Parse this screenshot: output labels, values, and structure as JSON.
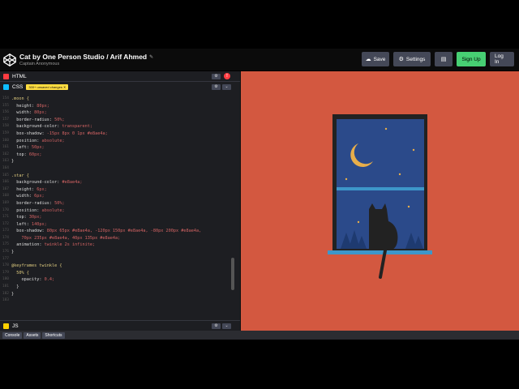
{
  "header": {
    "title": "Cat by One Person Studio / Arif Ahmed",
    "author": "Captain Anonymous",
    "buttons": {
      "save": "Save",
      "settings": "Settings",
      "signup": "Sign Up",
      "login": "Log In"
    }
  },
  "panels": {
    "html": {
      "label": "HTML",
      "error_count": "!"
    },
    "css": {
      "label": "CSS",
      "badge": "300+ unsaved changes ✕"
    },
    "js": {
      "label": "JS"
    }
  },
  "code_lines": [
    {
      "n": "154",
      "t": ".moon {",
      "cls": "sel"
    },
    {
      "n": "155",
      "t": "  height: 80px;",
      "cls": "decl",
      "prop": "  height",
      "val": "80px"
    },
    {
      "n": "156",
      "t": "  width: 80px;",
      "cls": "decl",
      "prop": "  width",
      "val": "80px"
    },
    {
      "n": "157",
      "t": "  border-radius: 50%;",
      "cls": "decl",
      "prop": "  border-radius",
      "val": "50%"
    },
    {
      "n": "158",
      "t": "  background-color: transparent;",
      "cls": "decl",
      "prop": "  background-color",
      "val": "transparent"
    },
    {
      "n": "159",
      "t": "  box-shadow: -15px 8px 0 1px #e8ae4a;",
      "cls": "decl",
      "prop": "  box-shadow",
      "val": "-15px 8px 0 1px #e8ae4a"
    },
    {
      "n": "160",
      "t": "  position: absolute;",
      "cls": "decl",
      "prop": "  position",
      "val": "absolute"
    },
    {
      "n": "161",
      "t": "  left: 50px;",
      "cls": "decl",
      "prop": "  left",
      "val": "50px"
    },
    {
      "n": "162",
      "t": "  top: 60px;",
      "cls": "decl",
      "prop": "  top",
      "val": "60px"
    },
    {
      "n": "163",
      "t": "}",
      "cls": "plain"
    },
    {
      "n": "164",
      "t": "",
      "cls": "plain"
    },
    {
      "n": "165",
      "t": ".star {",
      "cls": "sel"
    },
    {
      "n": "166",
      "t": "  background-color: #e8ae4a;",
      "cls": "decl",
      "prop": "  background-color",
      "val": "#e8ae4a"
    },
    {
      "n": "167",
      "t": "  height: 6px;",
      "cls": "decl",
      "prop": "  height",
      "val": "6px"
    },
    {
      "n": "168",
      "t": "  width: 6px;",
      "cls": "decl",
      "prop": "  width",
      "val": "6px"
    },
    {
      "n": "169",
      "t": "  border-radius: 50%;",
      "cls": "decl",
      "prop": "  border-radius",
      "val": "50%"
    },
    {
      "n": "170",
      "t": "  position: absolute;",
      "cls": "decl",
      "prop": "  position",
      "val": "absolute"
    },
    {
      "n": "171",
      "t": "  top: 30px;",
      "cls": "decl",
      "prop": "  top",
      "val": "30px"
    },
    {
      "n": "172",
      "t": "  left: 140px;",
      "cls": "decl",
      "prop": "  left",
      "val": "140px"
    },
    {
      "n": "173",
      "t": "  box-shadow: 80px 65px #e8ae4a, -120px 150px #e8ae4a, -80px 200px #e8ae4a,",
      "cls": "decl",
      "prop": "  box-shadow",
      "val": "80px 65px #e8ae4a, -120px 150px #e8ae4a, -80px 200px #e8ae4a,"
    },
    {
      "n": "174",
      "t": "    70px 235px #e8ae4a, 40px 135px #e8ae4a;",
      "cls": "cont"
    },
    {
      "n": "175",
      "t": "  animation: twinkle 2s infinite;",
      "cls": "decl",
      "prop": "  animation",
      "val": "twinkle 2s infinite"
    },
    {
      "n": "176",
      "t": "}",
      "cls": "plain"
    },
    {
      "n": "177",
      "t": "",
      "cls": "plain"
    },
    {
      "n": "178",
      "t": "@keyframes twinkle {",
      "cls": "sel"
    },
    {
      "n": "179",
      "t": "  50% {",
      "cls": "sel"
    },
    {
      "n": "180",
      "t": "    opacity: 0.4;",
      "cls": "decl",
      "prop": "    opacity",
      "val": "0.4"
    },
    {
      "n": "181",
      "t": "  }",
      "cls": "plain"
    },
    {
      "n": "182",
      "t": "}",
      "cls": "plain"
    },
    {
      "n": "183",
      "t": "",
      "cls": "plain"
    }
  ],
  "footer": {
    "tabs": [
      "Console",
      "Assets",
      "Shortcuts"
    ]
  },
  "colors": {
    "background": "#d35840",
    "window_frame": "#222222",
    "sky": "#2b4a8a",
    "moon": "#e8ae4a",
    "sill": "#3d96c9",
    "cat": "#222222"
  }
}
